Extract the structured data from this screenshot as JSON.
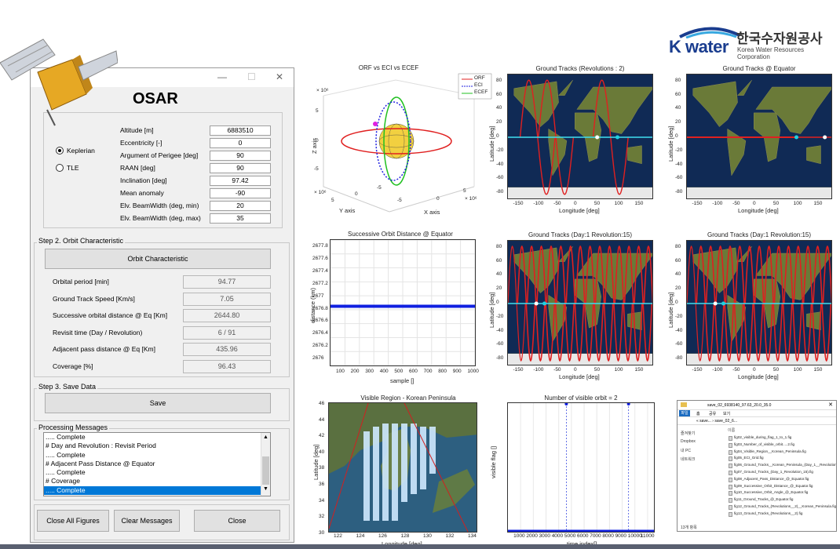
{
  "logo": {
    "brand": "K water",
    "korean": "한국수자원공사",
    "english": "Korea Water Resources Corporation"
  },
  "window": {
    "title": "OSAR",
    "controls": [
      "—",
      "☐",
      "✕"
    ],
    "orbit_type": {
      "options": [
        "Keplerian",
        "TLE"
      ],
      "selected": "Keplerian"
    },
    "params": [
      {
        "label": "Altitude [m]",
        "value": "6883510"
      },
      {
        "label": "Eccentricity [-]",
        "value": "0"
      },
      {
        "label": "Argument of Perigee [deg]",
        "value": "90"
      },
      {
        "label": "RAAN [deg]",
        "value": "90"
      },
      {
        "label": "Inclination [deg]",
        "value": "97.42"
      },
      {
        "label": "Mean anomaly",
        "value": "-90"
      },
      {
        "label": "Elv. BeamWidth (deg, min)",
        "value": "20"
      },
      {
        "label": "Elv. BeamWidth (deg, max)",
        "value": "35"
      }
    ],
    "step2": {
      "title": "Step 2. Orbit Characteristic",
      "button": "Orbit Characteristic",
      "results": [
        {
          "label": "Orbital period [min]",
          "value": "94.77"
        },
        {
          "label": "Ground Track Speed [Km/s]",
          "value": "7.05"
        },
        {
          "label": "Successive orbital distance @ Eq [Km]",
          "value": "2644.80"
        },
        {
          "label": "Revisit time (Day / Revolution)",
          "value": "6 / 91"
        },
        {
          "label": "Adjacent pass distance @ Eq [Km]",
          "value": "435.96"
        },
        {
          "label": "Coverage [%]",
          "value": "96.43"
        }
      ]
    },
    "step3": {
      "title": "Step 3. Save Data",
      "button": "Save"
    },
    "messages": {
      "title": "Processing Messages",
      "lines": [
        "..... Complete",
        "# Day and Revolution : Revisit Period",
        "..... Complete",
        "# Adjacent Pass Distance @ Equator",
        "..... Complete",
        "# Coverage",
        "..... Complete"
      ],
      "selected_index": 6
    },
    "buttons": {
      "close_all": "Close All Figures",
      "clear": "Clear Messages",
      "close": "Close"
    }
  },
  "plots": {
    "orbit3d": {
      "title": "ORF  vs  ECI  vs  ECEF",
      "legend": [
        "ORF",
        "ECI",
        "ECEF"
      ],
      "legend_colors": [
        "#e02020",
        "#2020e0",
        "#20c020"
      ],
      "zlabel": "Z axis",
      "ylabel": "Y axis",
      "xlabel": "X axis",
      "exp": "× 10⁶",
      "zticks": [
        "5",
        "0",
        "-5"
      ],
      "yticks": [
        "5",
        "0",
        "-5"
      ],
      "xticks": [
        "-5",
        "0",
        "5"
      ]
    },
    "gt_rev2": {
      "title": "Ground Tracks (Revolutions : 2)"
    },
    "gt_eq": {
      "title": "Ground Tracks @ Equator"
    },
    "gt_day1_a": {
      "title": "Ground Tracks (Day:1 Revolution:15)"
    },
    "gt_day1_b": {
      "title": "Ground Tracks (Day:1 Revolution:15)"
    },
    "map_axes": {
      "ylabel": "Latitude [deg]",
      "xlabel": "Longitude [deg]",
      "yticks": [
        "80",
        "60",
        "40",
        "20",
        "0",
        "-20",
        "-40",
        "-60",
        "-80"
      ],
      "xticks": [
        "-150",
        "-100",
        "-50",
        "0",
        "50",
        "100",
        "150"
      ]
    },
    "successive": {
      "title": "Successive Orbit Distance @ Equator",
      "ylabel": "distance (km)",
      "xlabel": "sample []",
      "yticks": [
        "2677.8",
        "2677.6",
        "2677.4",
        "2677.2",
        "2677",
        "2676.8",
        "2676.6",
        "2676.4",
        "2676.2",
        "2676"
      ],
      "xticks": [
        "100",
        "200",
        "300",
        "400",
        "500",
        "600",
        "700",
        "800",
        "900",
        "1000"
      ]
    },
    "visible_region": {
      "title": "Visible Region - Korean Peninsula",
      "ylabel": "Latitude [deg]",
      "xlabel": "Longitude [deg]",
      "yticks": [
        "46",
        "44",
        "42",
        "40",
        "38",
        "36",
        "34",
        "32",
        "30"
      ],
      "xticks": [
        "122",
        "124",
        "126",
        "128",
        "130",
        "132",
        "134"
      ]
    },
    "visible_orbit": {
      "title": "Number of visible orbit = 2",
      "ylabel": "visible flag []",
      "xlabel": "time index[]",
      "xticks": [
        "1000",
        "2000",
        "3000",
        "4000",
        "5000",
        "6000",
        "7000",
        "8000",
        "9000",
        "10000",
        "11000"
      ]
    }
  },
  "chart_data": [
    {
      "type": "line",
      "title": "Successive Orbit Distance @ Equator",
      "xlabel": "sample []",
      "ylabel": "distance (km)",
      "xlim": [
        0,
        1000
      ],
      "ylim": [
        2676,
        2677.8
      ],
      "series": [
        {
          "x": [
            0,
            1000
          ],
          "values": [
            2676.85,
            2676.85
          ]
        }
      ]
    },
    {
      "type": "line",
      "title": "Number of visible orbit = 2",
      "xlabel": "time index[]",
      "ylabel": "visible flag []",
      "xlim": [
        0,
        11500
      ],
      "ylim": [
        0,
        1
      ],
      "series": [
        {
          "x": [
            4600,
            9500
          ],
          "values": [
            1,
            1
          ]
        }
      ]
    }
  ],
  "explorer": {
    "path": "save_02_6938140_97.63_20.0_35.0",
    "crumbs": "« save... › save_02_6...",
    "tabs": [
      "파일",
      "홈",
      "공유",
      "보기"
    ],
    "side": [
      "즐겨찾기",
      "Dropbox",
      "내 PC",
      "네트워크"
    ],
    "column": "이름",
    "files": [
      "fig02_visible_during_flag_1_to_1.fig",
      "fig03_Number_of_visible_orbit.....2.fig",
      "fig04_Visible_Region__Korean_Peninsula.fig",
      "fig05_ECI_Grid.fig",
      "fig06_Ground_Tracks__Korean_Peninsula_(Day_1__Revolution_15).fig",
      "fig07_Ground_Tracks_(Day_1_Revolution_15).fig",
      "fig08_Adjacent_Pass_Distance_@_Equator.fig",
      "fig09_Successive_Orbit_Distance_@_Equator.fig",
      "fig10_Successive_Orbit_Angle_@_Equator.fig",
      "fig11_Ground_Tracks_@_Equator.fig",
      "fig12_Ground_Tracks_(Revolutions__2)__Korean_Peninsula.fig",
      "fig13_Ground_Tracks_(Revolutions__2).fig"
    ],
    "status": "13개 항목"
  }
}
